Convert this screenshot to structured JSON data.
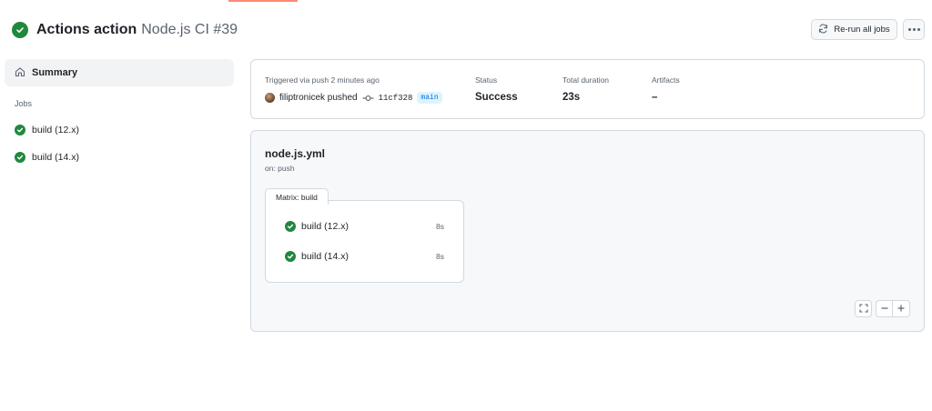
{
  "header": {
    "title_bold": "Actions action",
    "title_light": "Node.js CI #39",
    "status_icon": "check-circle-fill-icon",
    "rerun_label": "Re-run all jobs",
    "rerun_icon": "sync-icon",
    "more_icon": "kebab-horizontal-icon"
  },
  "sidebar": {
    "summary_label": "Summary",
    "summary_icon": "home-icon",
    "jobs_heading": "Jobs",
    "jobs": [
      {
        "label": "build (12.x)",
        "icon": "check-circle-fill-icon"
      },
      {
        "label": "build (14.x)",
        "icon": "check-circle-fill-icon"
      }
    ]
  },
  "summary": {
    "trigger_label": "Triggered via push 2 minutes ago",
    "actor": "filiptronicek pushed",
    "commit_sha": "11cf328",
    "branch": "main",
    "status_label": "Status",
    "status_value": "Success",
    "duration_label": "Total duration",
    "duration_value": "23s",
    "artifacts_label": "Artifacts",
    "artifacts_value": "–"
  },
  "workflow": {
    "file_name": "node.js.yml",
    "trigger": "on: push",
    "matrix_label": "Matrix: build",
    "jobs": [
      {
        "label": "build (12.x)",
        "duration": "8s"
      },
      {
        "label": "build (14.x)",
        "duration": "8s"
      }
    ]
  },
  "colors": {
    "success": "#1f883d",
    "link": "#0969da",
    "progress_bar": "#fd8c73"
  }
}
